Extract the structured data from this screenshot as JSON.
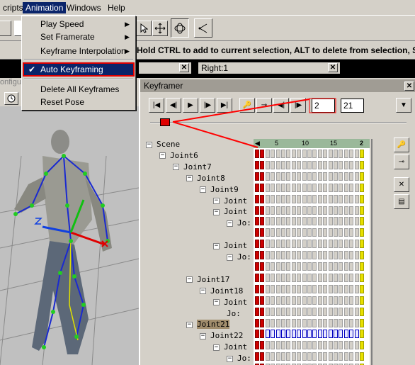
{
  "menubar": {
    "items": [
      "cripts",
      "Animation",
      "Windows",
      "Help"
    ]
  },
  "statusbar": {
    "message": "Hold CTRL to add to current selection, ALT to delete from selection, S"
  },
  "panels": {
    "configure_fragment": "onfigure",
    "right_view_title": "Right:1"
  },
  "animation_menu": {
    "items": [
      {
        "label": "Play Speed",
        "submenu": true
      },
      {
        "label": "Set Framerate",
        "submenu": true
      },
      {
        "label": "Keyframe Interpolation",
        "submenu": true
      },
      {
        "label": "Auto Keyframing",
        "checked": true
      },
      {
        "label": "Delete All Keyframes"
      },
      {
        "label": "Reset Pose"
      }
    ]
  },
  "keyframer": {
    "title": "Keyframer",
    "current_frame": "2",
    "total_frames": "21",
    "ruler_ticks": [
      "5",
      "10",
      "15"
    ],
    "ruler_end": "2",
    "tree": [
      {
        "label": "Scene",
        "indent": 0,
        "toggle": "minus"
      },
      {
        "label": "Joint6",
        "indent": 1,
        "toggle": "minus"
      },
      {
        "label": "Joint7",
        "indent": 2,
        "toggle": "minus"
      },
      {
        "label": "Joint8",
        "indent": 3,
        "toggle": "minus"
      },
      {
        "label": "Joint9",
        "indent": 4,
        "toggle": "minus"
      },
      {
        "label": "Joint",
        "indent": 5,
        "toggle": "minus"
      },
      {
        "label": "Joint",
        "indent": 5,
        "toggle": "minus"
      },
      {
        "label": "Jo:",
        "indent": 6,
        "toggle": "minus"
      },
      {
        "label": "",
        "indent": 6,
        "toggle": "none"
      },
      {
        "label": "Joint",
        "indent": 5,
        "toggle": "minus"
      },
      {
        "label": "Jo:",
        "indent": 6,
        "toggle": "minus"
      },
      {
        "label": "",
        "indent": 6,
        "toggle": "none"
      },
      {
        "label": "Joint17",
        "indent": 3,
        "toggle": "minus"
      },
      {
        "label": "Joint18",
        "indent": 4,
        "toggle": "minus"
      },
      {
        "label": "Joint",
        "indent": 5,
        "toggle": "minus"
      },
      {
        "label": "Jo:",
        "indent": 6,
        "toggle": "none"
      },
      {
        "label": "Joint21",
        "indent": 3,
        "toggle": "minus",
        "selected": true
      },
      {
        "label": "Joint22",
        "indent": 4,
        "toggle": "minus"
      },
      {
        "label": "Joint",
        "indent": 5,
        "toggle": "minus"
      },
      {
        "label": "Jo:",
        "indent": 6,
        "toggle": "minus"
      }
    ]
  },
  "colors": {
    "menu_highlight": "#0a246a",
    "keyframe_red": "#cc0000",
    "current_frame_yellow": "#e8e000",
    "selected_row_blue": "#0000c0",
    "callout_red": "#ff0000"
  }
}
